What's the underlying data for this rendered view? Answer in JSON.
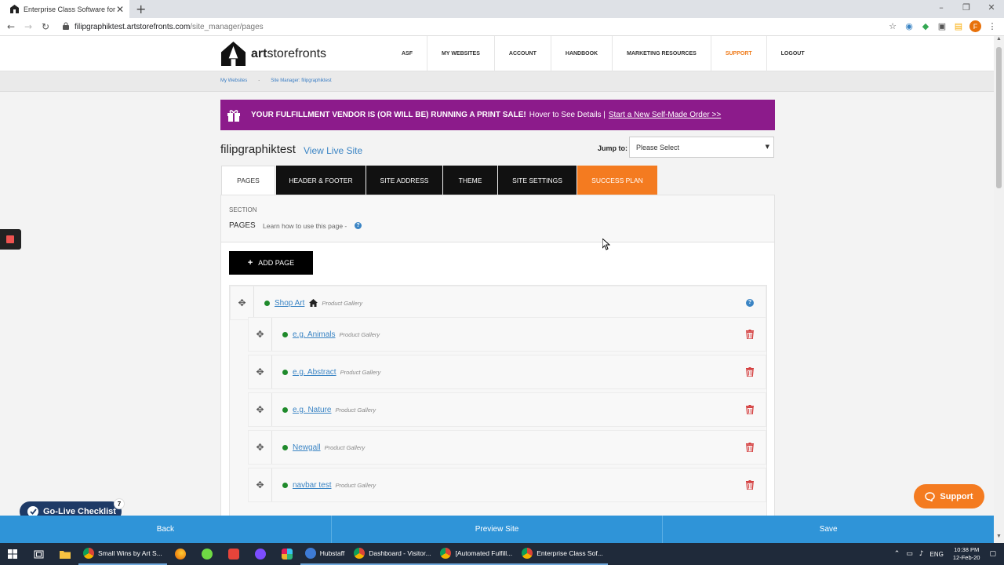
{
  "browser": {
    "tab_title": "Enterprise Class Software for Pri",
    "url_host": "filipgraphiktest.artstorefronts.com",
    "url_path": "/site_manager/pages",
    "profile_initial": "F"
  },
  "header": {
    "logo_prefix": "art",
    "logo_suffix": "storefronts",
    "nav": [
      {
        "label": "ASF"
      },
      {
        "label": "MY WEBSITES"
      },
      {
        "label": "ACCOUNT"
      },
      {
        "label": "HANDBOOK"
      },
      {
        "label": "MARKETING RESOURCES"
      },
      {
        "label": "SUPPORT"
      },
      {
        "label": "LOGOUT"
      }
    ]
  },
  "breadcrumb": [
    "My Websites",
    "-",
    "Site Manager: filipgraphiktest"
  ],
  "sale_banner": {
    "bold": "YOUR FULFILLMENT VENDOR IS (OR WILL BE) RUNNING A PRINT SALE!",
    "text": "Hover to See Details |",
    "link": "Start a New Self-Made Order >>"
  },
  "site": {
    "name": "filipgraphiktest",
    "view_live": "View Live Site"
  },
  "jump": {
    "label": "Jump to:",
    "value": "Please Select"
  },
  "tabs": [
    "PAGES",
    "HEADER & FOOTER",
    "SITE ADDRESS",
    "THEME",
    "SITE SETTINGS",
    "SUCCESS PLAN"
  ],
  "section": {
    "label": "SECTION",
    "name": "PAGES",
    "learn": "Learn how to use this page -",
    "help": "?"
  },
  "add_page": "ADD PAGE",
  "pages": [
    {
      "title": "Shop Art",
      "type": "Product Gallery"
    },
    {
      "title": "e.g. Animals",
      "type": "Product Gallery"
    },
    {
      "title": "e.g. Abstract",
      "type": "Product Gallery"
    },
    {
      "title": "e.g. Nature",
      "type": "Product Gallery"
    },
    {
      "title": "Newgall",
      "type": "Product Gallery"
    },
    {
      "title": "navbar test",
      "type": "Product Gallery"
    }
  ],
  "widgets": {
    "golive": "Go-Live Checklist",
    "golive_count": "7",
    "support": "Support"
  },
  "footer": [
    "Back",
    "Preview Site",
    "Save"
  ],
  "taskbar": {
    "apps": [
      "Small Wins by Art S...",
      "Hubstaff",
      "Dashboard - Visitor...",
      "[Automated Fulfill...",
      "Enterprise Class Sof..."
    ],
    "lang": "ENG",
    "time": "10:38 PM",
    "date": "12-Feb-20"
  },
  "colors": {
    "brand_purple": "#8c1b8b",
    "accent_orange": "#f47b20",
    "link_blue": "#3a84c4",
    "footer_blue": "#2f94d8"
  }
}
